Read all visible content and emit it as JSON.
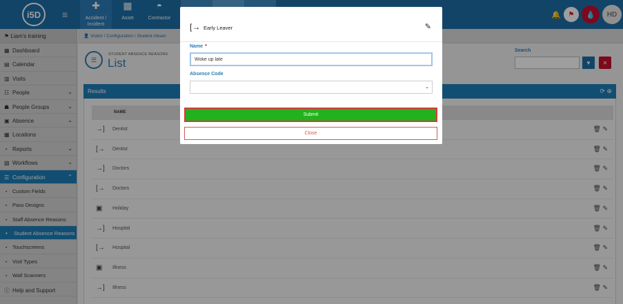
{
  "topbar": {
    "logo": "i5D",
    "modules": [
      {
        "label": "Accident / Incident",
        "icon": "medkit-icon"
      },
      {
        "label": "Asset",
        "icon": "boxes-icon"
      },
      {
        "label": "Contractor",
        "icon": "helmet-icon"
      }
    ],
    "user_initials": "HD"
  },
  "sidebar": {
    "org": "Liam's training",
    "items": [
      {
        "label": "Dashboard",
        "icon": "▦"
      },
      {
        "label": "Calendar",
        "icon": "▤"
      },
      {
        "label": "Visits",
        "icon": "▥"
      },
      {
        "label": "People",
        "icon": "☷"
      },
      {
        "label": "People Groups",
        "icon": "☗"
      },
      {
        "label": "Absence",
        "icon": "▣"
      },
      {
        "label": "Locations",
        "icon": "▦"
      },
      {
        "label": "Reports",
        "icon": "◔"
      },
      {
        "label": "Workflows",
        "icon": "▧"
      },
      {
        "label": "Configuration",
        "icon": "☰"
      }
    ],
    "sub_items": [
      "Custom Fields",
      "Pass Designs",
      "Staff Absence Reasons",
      "Student Absence Reasons",
      "Touchscreens",
      "Visit Types",
      "Wall Scanners"
    ],
    "help": "Help and Support"
  },
  "main": {
    "breadcrumb": [
      "Visitor",
      "Configuration",
      "Student Absen"
    ],
    "subtitle": "STUDENT ABSENCE REASONS",
    "title": "List",
    "search_label": "Search",
    "results_label": "Results",
    "column_name": "NAME",
    "rows": [
      {
        "name": "Dentist",
        "icon": "→]"
      },
      {
        "name": "Dentist",
        "icon": "[→"
      },
      {
        "name": "Doctors",
        "icon": "→]"
      },
      {
        "name": "Doctors",
        "icon": "[→"
      },
      {
        "name": "Holiday",
        "icon": "▣"
      },
      {
        "name": "Hospital",
        "icon": "→]"
      },
      {
        "name": "Hospital",
        "icon": "[→"
      },
      {
        "name": "Illness",
        "icon": "▣"
      },
      {
        "name": "Illness",
        "icon": "→]"
      }
    ]
  },
  "modal": {
    "header_title": "Early Leaver",
    "name_label": "Name",
    "required_mark": "*",
    "name_value": "Woke up late",
    "absence_code_label": "Absence Code",
    "absence_code_value": "",
    "submit_label": "Submit",
    "close_label": "Close"
  }
}
